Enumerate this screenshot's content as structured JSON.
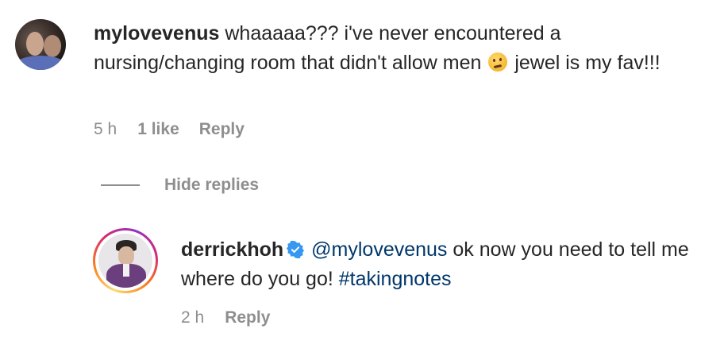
{
  "comment": {
    "username": "mylovevenus",
    "text_part1": "whaaaaa??? i've never encountered a nursing/changing room that didn't allow men",
    "emoji_icon": "thinking-face-icon",
    "text_part2": "jewel is my fav!!!",
    "time": "5 h",
    "likes": "1 like",
    "reply_label": "Reply"
  },
  "hide_replies_label": "Hide replies",
  "reply": {
    "username": "derrickhoh",
    "verified_icon": "verified-badge-icon",
    "mention": "@mylovevenus",
    "text_part1": "ok now you need to tell me where do you go!",
    "hashtag": "#takingnotes",
    "time": "2 h",
    "reply_label": "Reply"
  },
  "colors": {
    "text": "#262626",
    "secondary": "#8e8e8e",
    "link": "#00376b",
    "verified": "#3897f0"
  }
}
